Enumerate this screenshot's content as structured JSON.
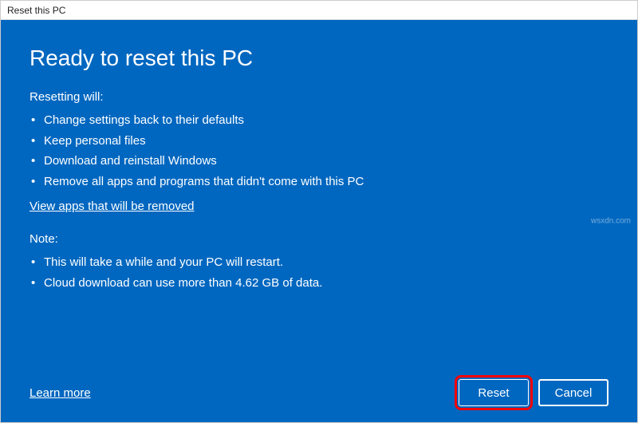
{
  "window": {
    "title": "Reset this PC"
  },
  "heading": "Ready to reset this PC",
  "resetting": {
    "label": "Resetting will:",
    "items": [
      "Change settings back to their defaults",
      "Keep personal files",
      "Download and reinstall Windows",
      "Remove all apps and programs that didn't come with this PC"
    ]
  },
  "view_apps_link": "View apps that will be removed",
  "note": {
    "label": "Note:",
    "items": [
      "This will take a while and your PC will restart.",
      "Cloud download can use more than 4.62 GB of data."
    ]
  },
  "learn_more": "Learn more",
  "buttons": {
    "reset": "Reset",
    "cancel": "Cancel"
  },
  "watermark": "wsxdn.com"
}
